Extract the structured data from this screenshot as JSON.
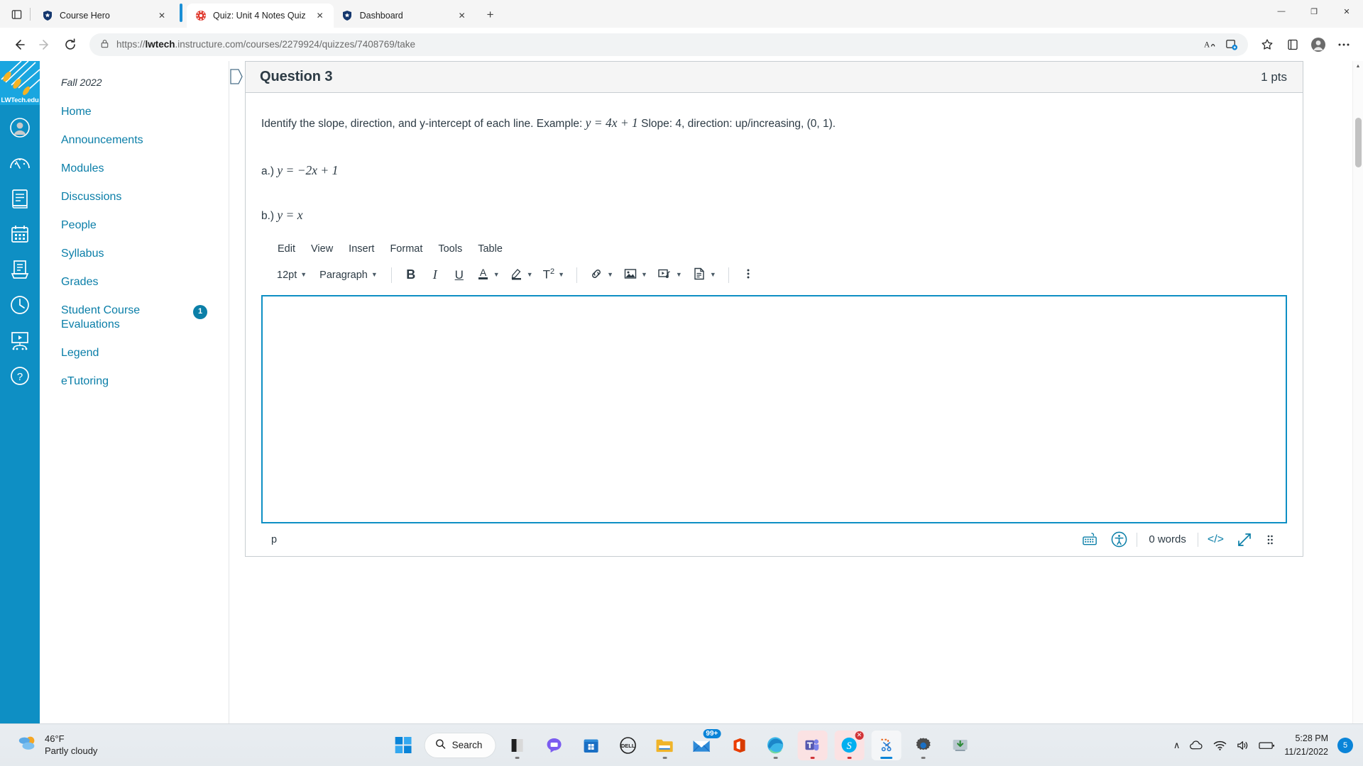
{
  "browser": {
    "tabs": [
      {
        "title": "Course Hero",
        "favicon": "shield-blue-icon",
        "active": false
      },
      {
        "title": "Quiz: Unit 4 Notes Quiz",
        "favicon": "canvas-red-icon",
        "active": true
      },
      {
        "title": "Dashboard",
        "favicon": "shield-blue-icon",
        "active": false
      }
    ],
    "new_tab_label": "+",
    "window_controls": {
      "minimize": "—",
      "maximize": "❐",
      "close": "✕"
    },
    "nav": {
      "back": "←",
      "forward": "→",
      "reload": "⟳"
    },
    "address": {
      "lock_icon": "lock-icon",
      "scheme": "https://",
      "host_bold": "lwtech",
      "host_rest": ".instructure.com",
      "path": "/courses/2279924/quizzes/7408769/take",
      "full": "https://lwtech.instructure.com/courses/2279924/quizzes/7408769/take"
    },
    "toolbar_icons": [
      "read-aloud-icon",
      "collections-add-icon",
      "favorites-icon",
      "collections-icon",
      "profile-icon",
      "settings-more-icon"
    ]
  },
  "global_nav": {
    "logo_label": "LWTech.edu",
    "items": [
      {
        "name": "account",
        "icon": "account-avatar-icon"
      },
      {
        "name": "dashboard",
        "icon": "dashboard-gauge-icon"
      },
      {
        "name": "courses",
        "icon": "courses-book-icon"
      },
      {
        "name": "calendar",
        "icon": "calendar-icon"
      },
      {
        "name": "inbox",
        "icon": "inbox-tray-icon"
      },
      {
        "name": "history",
        "icon": "clock-icon"
      },
      {
        "name": "studio",
        "icon": "studio-screen-icon"
      },
      {
        "name": "help",
        "icon": "help-question-icon"
      }
    ],
    "collapse_icon": "collapse-arrow-icon"
  },
  "course_nav": {
    "term": "Fall 2022",
    "items": [
      {
        "label": "Home",
        "badge": null
      },
      {
        "label": "Announcements",
        "badge": null
      },
      {
        "label": "Modules",
        "badge": null
      },
      {
        "label": "Discussions",
        "badge": null
      },
      {
        "label": "People",
        "badge": null
      },
      {
        "label": "Syllabus",
        "badge": null
      },
      {
        "label": "Grades",
        "badge": null
      },
      {
        "label": "Student Course Evaluations",
        "badge": "1"
      },
      {
        "label": "Legend",
        "badge": null
      },
      {
        "label": "eTutoring",
        "badge": null
      }
    ]
  },
  "question": {
    "flag_icon": "flag-question-icon",
    "title": "Question 3",
    "points": "1 pts",
    "prompt_prefix": "Identify the slope, direction, and y-intercept of each line. Example: ",
    "prompt_math": "y = 4x + 1",
    "prompt_suffix": " Slope: 4, direction: up/increasing, (0, 1).",
    "items": [
      {
        "lead": "a.)",
        "math": "y = −2x + 1"
      },
      {
        "lead": "b.)",
        "math": "y = x"
      }
    ]
  },
  "editor": {
    "menus": [
      "Edit",
      "View",
      "Insert",
      "Format",
      "Tools",
      "Table"
    ],
    "font_size": "12pt",
    "block_format": "Paragraph",
    "buttons": [
      {
        "name": "bold-button",
        "glyph": "B"
      },
      {
        "name": "italic-button",
        "glyph": "I"
      },
      {
        "name": "underline-button",
        "glyph": "U"
      },
      {
        "name": "text-color-button",
        "glyph": "A"
      },
      {
        "name": "highlight-color-button",
        "glyph": "highlighter-icon"
      },
      {
        "name": "superscript-subscript-button",
        "glyph": "T2"
      },
      {
        "name": "link-button",
        "glyph": "link-icon"
      },
      {
        "name": "image-button",
        "glyph": "image-icon"
      },
      {
        "name": "media-button",
        "glyph": "media-icon"
      },
      {
        "name": "document-button",
        "glyph": "document-icon"
      },
      {
        "name": "more-options-button",
        "glyph": "kebab-icon"
      }
    ],
    "content": "",
    "status": {
      "element_path": "p",
      "keyboard_shortcuts_icon": "keyboard-icon",
      "accessibility_checker_icon": "accessibility-icon",
      "word_count": "0 words",
      "html_editor_label": "</>",
      "fullscreen_icon": "fullscreen-arrows-icon",
      "resize_handle_icon": "resize-grip-icon"
    }
  },
  "taskbar": {
    "weather": {
      "temperature": "46°F",
      "condition": "Partly cloudy",
      "icon": "partly-cloudy-icon"
    },
    "start_label": "start-icon",
    "search_label": "Search",
    "apps": [
      {
        "name": "file-explorer-dark",
        "icon": "dark-app-icon",
        "state": "open"
      },
      {
        "name": "chat-teams",
        "icon": "chat-bubble-icon",
        "state": "idle"
      },
      {
        "name": "microsoft-store",
        "icon": "store-icon",
        "state": "idle"
      },
      {
        "name": "dell",
        "icon": "dell-icon",
        "state": "idle"
      },
      {
        "name": "file-explorer",
        "icon": "folder-icon",
        "state": "open"
      },
      {
        "name": "mail",
        "icon": "mail-icon",
        "badge": "99+"
      },
      {
        "name": "office",
        "icon": "office-icon",
        "state": "idle"
      },
      {
        "name": "edge",
        "icon": "edge-icon",
        "state": "open"
      },
      {
        "name": "teams",
        "icon": "teams-icon",
        "state": "alert"
      },
      {
        "name": "skype",
        "icon": "skype-icon",
        "state": "alert"
      },
      {
        "name": "snipping-tool",
        "icon": "scissors-icon",
        "state": "active"
      },
      {
        "name": "settings",
        "icon": "gear-icon",
        "state": "open"
      },
      {
        "name": "software-center",
        "icon": "download-icon",
        "state": "idle"
      }
    ],
    "tray": {
      "overflow": "∧",
      "onedrive_icon": "cloud-icon",
      "wifi_icon": "wifi-icon",
      "volume_icon": "volume-icon",
      "battery_icon": "battery-icon",
      "time": "5:28 PM",
      "date": "11/21/2022",
      "notification_count": "5"
    }
  }
}
